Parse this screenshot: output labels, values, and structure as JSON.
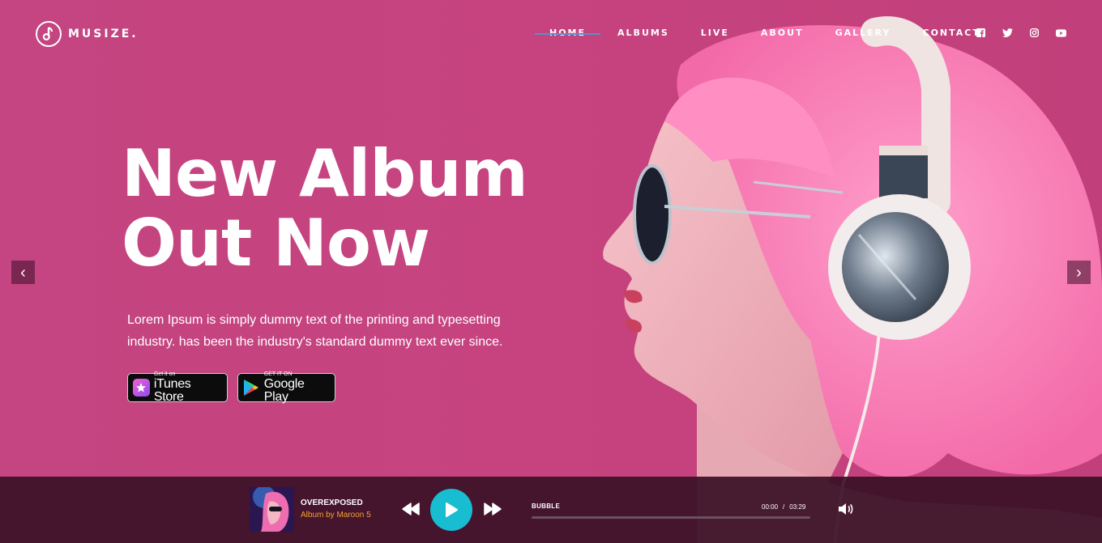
{
  "brand": {
    "name": "MUSIZE."
  },
  "nav": {
    "items": [
      {
        "label": "HOME"
      },
      {
        "label": "ALBUMS"
      },
      {
        "label": "LIVE"
      },
      {
        "label": "ABOUT"
      },
      {
        "label": "GALLERY"
      },
      {
        "label": "CONTACT"
      }
    ],
    "active": "HOME"
  },
  "socials": [
    "facebook-icon",
    "twitter-icon",
    "instagram-icon",
    "youtube-icon"
  ],
  "hero": {
    "headline_line1": "New Album",
    "headline_line2": "Out Now",
    "description": "Lorem Ipsum is simply dummy text of the printing and typesetting industry. has been the industry's standard dummy text ever since.",
    "itunes": {
      "small": "Get it on",
      "big": "iTunes Store"
    },
    "google": {
      "small": "GET IT ON",
      "big": "Google Play"
    },
    "prev_arrow": "‹",
    "next_arrow": "›"
  },
  "player": {
    "track_title": "OVEREXPOSED",
    "track_artist": "Album by Maroon 5",
    "song_name": "BUBBLE",
    "current_time": "00:00",
    "separator": "/",
    "duration": "03:29",
    "progress": 0
  },
  "colors": {
    "background": "#c44581",
    "player_bg": "#3a1026",
    "play_button": "#19bdd1",
    "artist_text": "#f2a52c",
    "active_nav_line": "#5a8fc8"
  }
}
